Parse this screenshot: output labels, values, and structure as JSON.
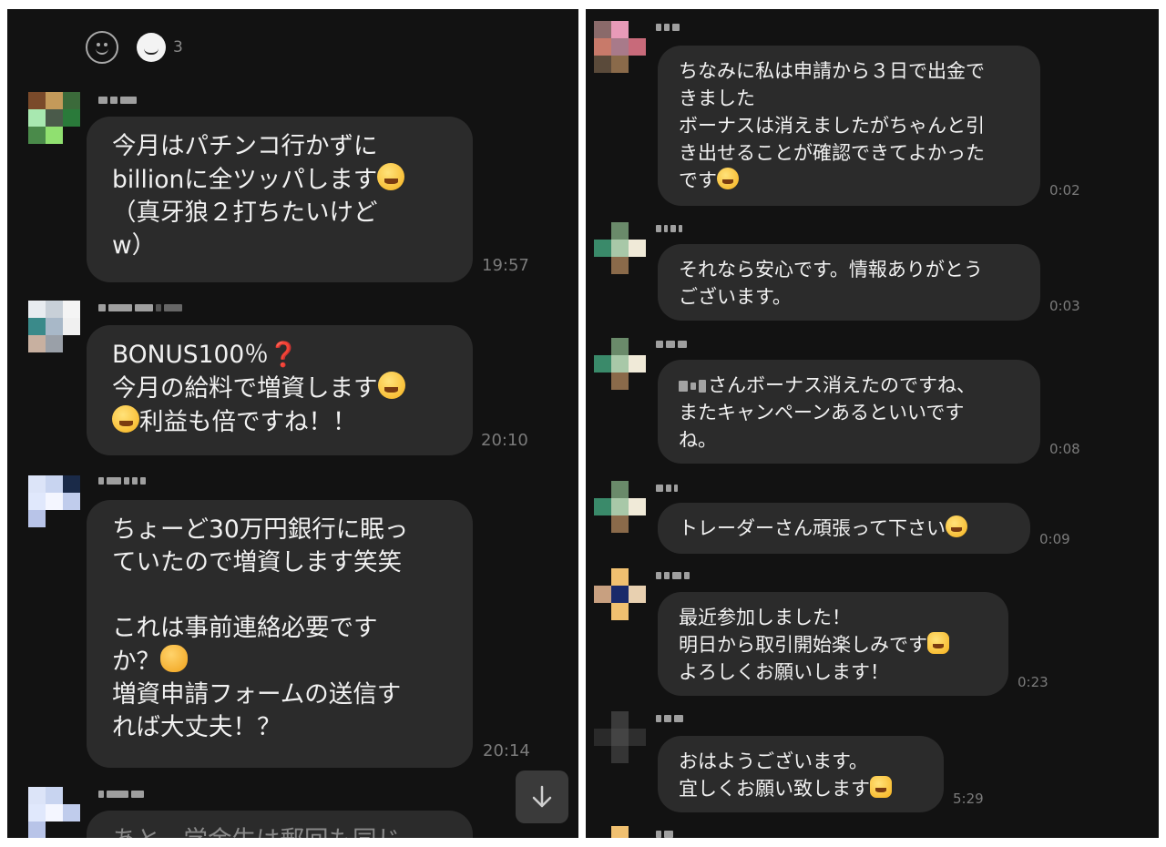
{
  "left": {
    "reaction_count": "3",
    "messages": [
      {
        "text": "今月はパチンコ行かずに\nbillionに全ツッパします",
        "tail": "\n（真牙狼２打ちたいけど\nw）",
        "time": "19:57"
      },
      {
        "text": "BONUS100％",
        "line2": "\n今月の給料で増資します",
        "line3": "利益も倍ですね！！",
        "time": "20:10"
      },
      {
        "text": "ちょーど30万円銀行に眠っ\nていたので増資します笑笑\n\nこれは事前連絡必要です\nか？",
        "tail": "\n増資申請フォームの送信す\nれば大丈夫！？",
        "time": "20:14"
      },
      {
        "text": "あと、学金生は郵回も同じ"
      }
    ]
  },
  "right": {
    "messages": [
      {
        "text": "ちなみに私は申請から３日で出金で\nきました\nボーナスは消えましたがちゃんと引\nき出せることが確認できてよかった\nです",
        "time": "0:02"
      },
      {
        "text": "それなら安心です。情報ありがとう\nございます。",
        "time": "0:03"
      },
      {
        "text": "さんボーナス消えたのですね、\nまたキャンペーンあるといいです\nね。",
        "time": "0:08"
      },
      {
        "text": "トレーダーさん頑張って下さい",
        "time": "0:09"
      },
      {
        "text": "最近参加しました！\n明日から取引開始楽しみです",
        "tail": "\nよろしくお願いします！",
        "time": "0:23"
      },
      {
        "text": "おはようございます。\n宜しくお願い致します",
        "time": "5:29"
      }
    ]
  },
  "colors": {
    "background": "#121212",
    "bubble": "#2b2b2b",
    "text": "#f1f1f1",
    "time": "#7b7b7b"
  },
  "icons": [
    "smiley-icon",
    "reaction-face-icon",
    "arrow-down-icon"
  ]
}
